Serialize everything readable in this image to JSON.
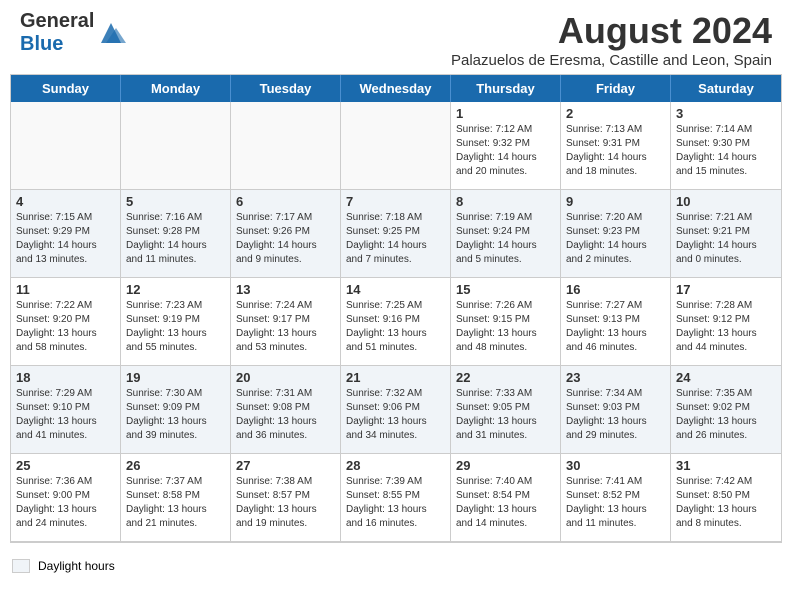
{
  "header": {
    "logo_general": "General",
    "logo_blue": "Blue",
    "month_title": "August 2024",
    "subtitle": "Palazuelos de Eresma, Castille and Leon, Spain"
  },
  "day_headers": [
    "Sunday",
    "Monday",
    "Tuesday",
    "Wednesday",
    "Thursday",
    "Friday",
    "Saturday"
  ],
  "legend": {
    "label": "Daylight hours"
  },
  "rows": [
    {
      "bg": "#fff",
      "cells": [
        {
          "day": "",
          "info": ""
        },
        {
          "day": "",
          "info": ""
        },
        {
          "day": "",
          "info": ""
        },
        {
          "day": "",
          "info": ""
        },
        {
          "day": "1",
          "info": "Sunrise: 7:12 AM\nSunset: 9:32 PM\nDaylight: 14 hours\nand 20 minutes."
        },
        {
          "day": "2",
          "info": "Sunrise: 7:13 AM\nSunset: 9:31 PM\nDaylight: 14 hours\nand 18 minutes."
        },
        {
          "day": "3",
          "info": "Sunrise: 7:14 AM\nSunset: 9:30 PM\nDaylight: 14 hours\nand 15 minutes."
        }
      ]
    },
    {
      "bg": "#f0f4f8",
      "cells": [
        {
          "day": "4",
          "info": "Sunrise: 7:15 AM\nSunset: 9:29 PM\nDaylight: 14 hours\nand 13 minutes."
        },
        {
          "day": "5",
          "info": "Sunrise: 7:16 AM\nSunset: 9:28 PM\nDaylight: 14 hours\nand 11 minutes."
        },
        {
          "day": "6",
          "info": "Sunrise: 7:17 AM\nSunset: 9:26 PM\nDaylight: 14 hours\nand 9 minutes."
        },
        {
          "day": "7",
          "info": "Sunrise: 7:18 AM\nSunset: 9:25 PM\nDaylight: 14 hours\nand 7 minutes."
        },
        {
          "day": "8",
          "info": "Sunrise: 7:19 AM\nSunset: 9:24 PM\nDaylight: 14 hours\nand 5 minutes."
        },
        {
          "day": "9",
          "info": "Sunrise: 7:20 AM\nSunset: 9:23 PM\nDaylight: 14 hours\nand 2 minutes."
        },
        {
          "day": "10",
          "info": "Sunrise: 7:21 AM\nSunset: 9:21 PM\nDaylight: 14 hours\nand 0 minutes."
        }
      ]
    },
    {
      "bg": "#fff",
      "cells": [
        {
          "day": "11",
          "info": "Sunrise: 7:22 AM\nSunset: 9:20 PM\nDaylight: 13 hours\nand 58 minutes."
        },
        {
          "day": "12",
          "info": "Sunrise: 7:23 AM\nSunset: 9:19 PM\nDaylight: 13 hours\nand 55 minutes."
        },
        {
          "day": "13",
          "info": "Sunrise: 7:24 AM\nSunset: 9:17 PM\nDaylight: 13 hours\nand 53 minutes."
        },
        {
          "day": "14",
          "info": "Sunrise: 7:25 AM\nSunset: 9:16 PM\nDaylight: 13 hours\nand 51 minutes."
        },
        {
          "day": "15",
          "info": "Sunrise: 7:26 AM\nSunset: 9:15 PM\nDaylight: 13 hours\nand 48 minutes."
        },
        {
          "day": "16",
          "info": "Sunrise: 7:27 AM\nSunset: 9:13 PM\nDaylight: 13 hours\nand 46 minutes."
        },
        {
          "day": "17",
          "info": "Sunrise: 7:28 AM\nSunset: 9:12 PM\nDaylight: 13 hours\nand 44 minutes."
        }
      ]
    },
    {
      "bg": "#f0f4f8",
      "cells": [
        {
          "day": "18",
          "info": "Sunrise: 7:29 AM\nSunset: 9:10 PM\nDaylight: 13 hours\nand 41 minutes."
        },
        {
          "day": "19",
          "info": "Sunrise: 7:30 AM\nSunset: 9:09 PM\nDaylight: 13 hours\nand 39 minutes."
        },
        {
          "day": "20",
          "info": "Sunrise: 7:31 AM\nSunset: 9:08 PM\nDaylight: 13 hours\nand 36 minutes."
        },
        {
          "day": "21",
          "info": "Sunrise: 7:32 AM\nSunset: 9:06 PM\nDaylight: 13 hours\nand 34 minutes."
        },
        {
          "day": "22",
          "info": "Sunrise: 7:33 AM\nSunset: 9:05 PM\nDaylight: 13 hours\nand 31 minutes."
        },
        {
          "day": "23",
          "info": "Sunrise: 7:34 AM\nSunset: 9:03 PM\nDaylight: 13 hours\nand 29 minutes."
        },
        {
          "day": "24",
          "info": "Sunrise: 7:35 AM\nSunset: 9:02 PM\nDaylight: 13 hours\nand 26 minutes."
        }
      ]
    },
    {
      "bg": "#fff",
      "cells": [
        {
          "day": "25",
          "info": "Sunrise: 7:36 AM\nSunset: 9:00 PM\nDaylight: 13 hours\nand 24 minutes."
        },
        {
          "day": "26",
          "info": "Sunrise: 7:37 AM\nSunset: 8:58 PM\nDaylight: 13 hours\nand 21 minutes."
        },
        {
          "day": "27",
          "info": "Sunrise: 7:38 AM\nSunset: 8:57 PM\nDaylight: 13 hours\nand 19 minutes."
        },
        {
          "day": "28",
          "info": "Sunrise: 7:39 AM\nSunset: 8:55 PM\nDaylight: 13 hours\nand 16 minutes."
        },
        {
          "day": "29",
          "info": "Sunrise: 7:40 AM\nSunset: 8:54 PM\nDaylight: 13 hours\nand 14 minutes."
        },
        {
          "day": "30",
          "info": "Sunrise: 7:41 AM\nSunset: 8:52 PM\nDaylight: 13 hours\nand 11 minutes."
        },
        {
          "day": "31",
          "info": "Sunrise: 7:42 AM\nSunset: 8:50 PM\nDaylight: 13 hours\nand 8 minutes."
        }
      ]
    }
  ]
}
